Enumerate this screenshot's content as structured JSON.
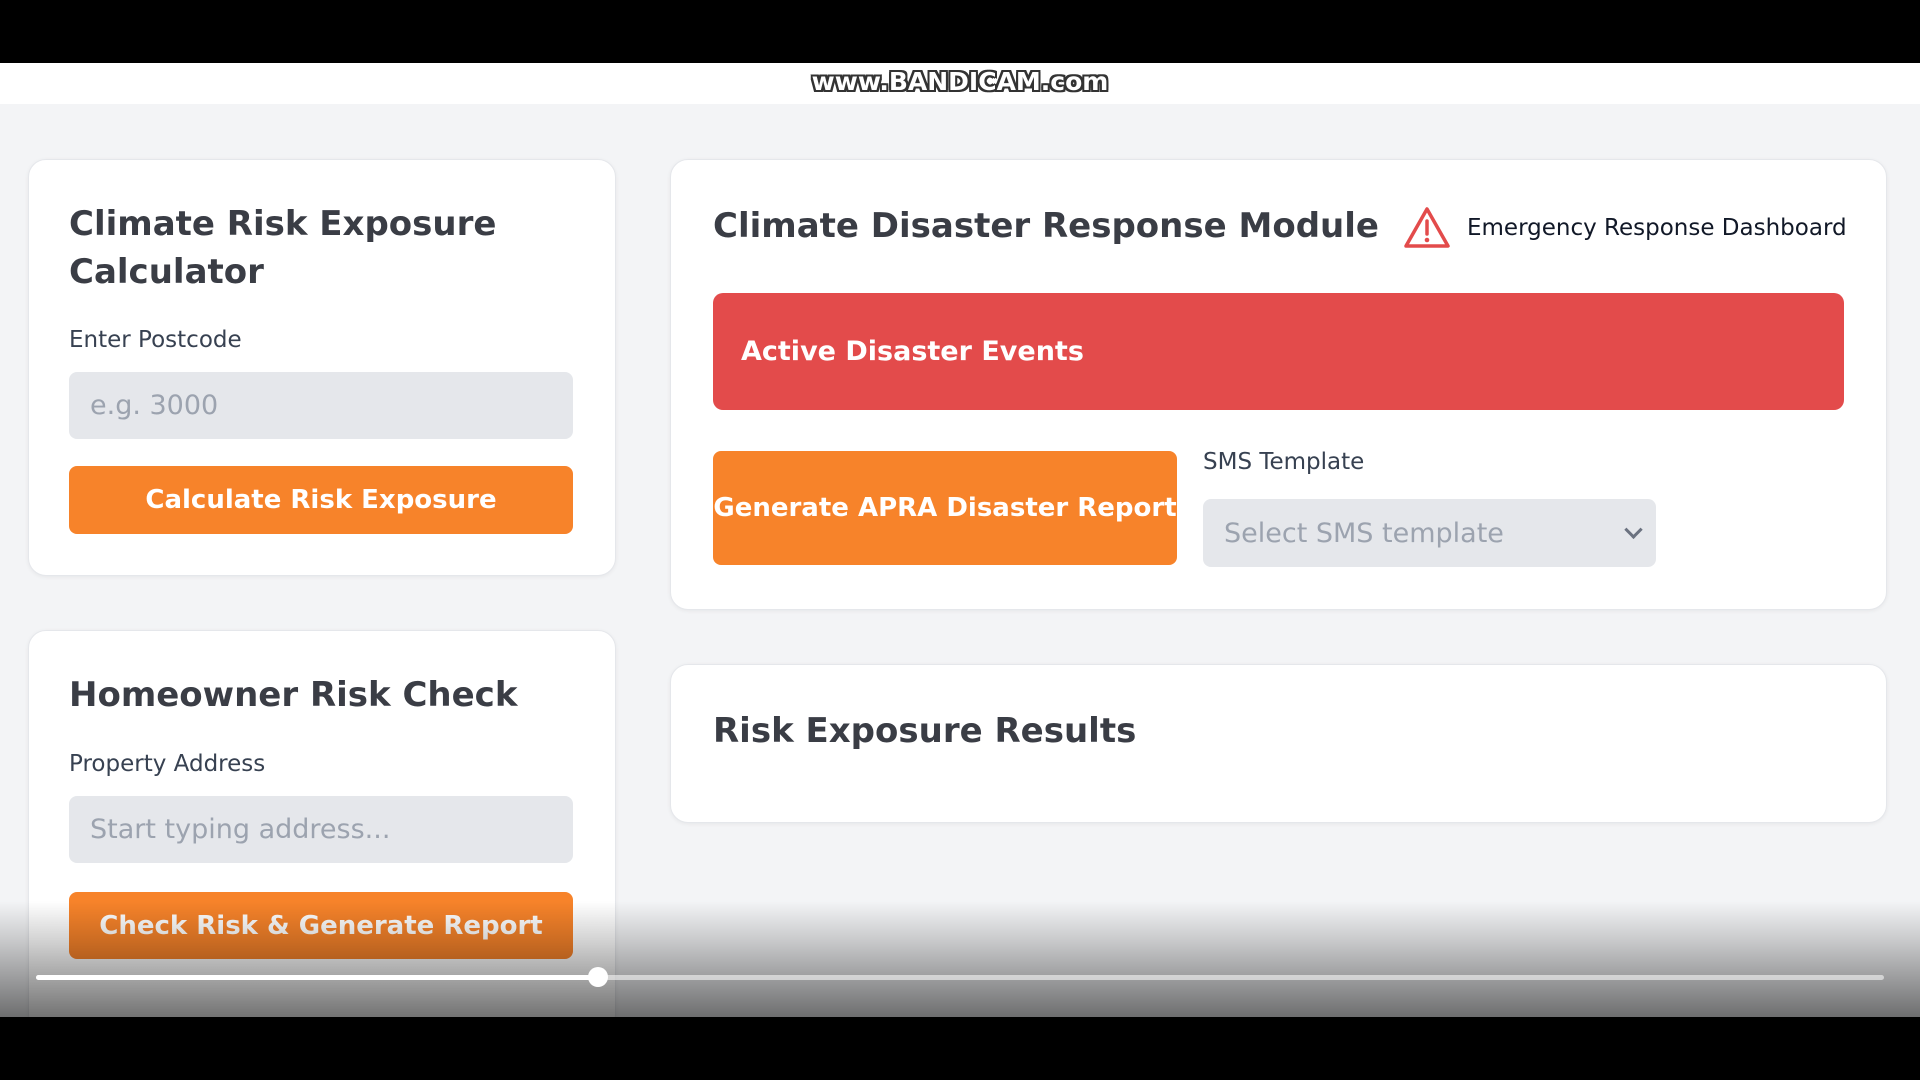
{
  "watermark": "www.BANDICAM.com",
  "risk_calculator": {
    "title": "Climate Risk Exposure Calculator",
    "postcode_label": "Enter Postcode",
    "postcode_placeholder": "e.g. 3000",
    "postcode_value": "",
    "button_label": "Calculate Risk Exposure"
  },
  "homeowner_check": {
    "title": "Homeowner Risk Check",
    "address_label": "Property Address",
    "address_placeholder": "Start typing address...",
    "address_value": "",
    "button_label": "Check Risk & Generate Report"
  },
  "disaster_module": {
    "title": "Climate Disaster Response Module",
    "dashboard_link": "Emergency Response Dashboard",
    "alert_icon": "warning-triangle-icon",
    "active_events_label": "Active Disaster Events",
    "report_button_label": "Generate APRA Disaster Report",
    "sms_label": "SMS Template",
    "sms_selected": "Select SMS template"
  },
  "results": {
    "title": "Risk Exposure Results"
  },
  "video_player": {
    "progress": 0.304
  },
  "colors": {
    "accent_orange": "#f7832a",
    "alert_red": "#e34b4b",
    "background": "#f3f4f6"
  }
}
